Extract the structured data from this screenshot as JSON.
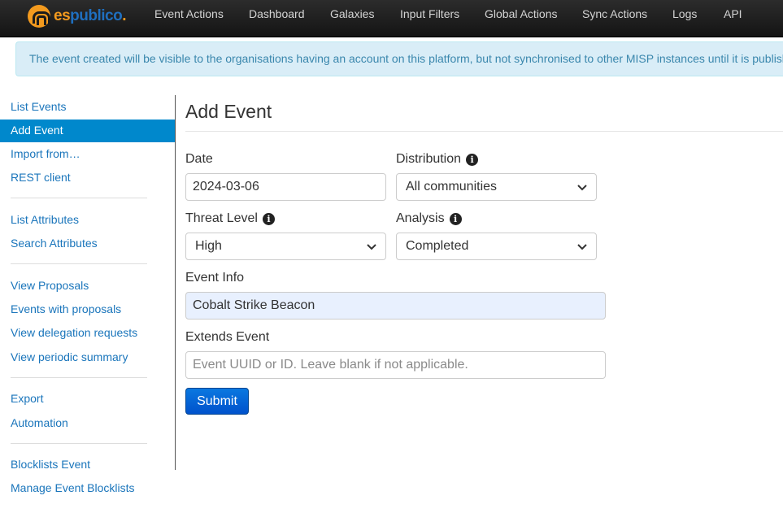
{
  "brand": {
    "text_es": "es",
    "text_publico": "publico",
    "text_dot": ".",
    "logo_icon": "espublico-logo-icon"
  },
  "nav": {
    "items": [
      "Event Actions",
      "Dashboard",
      "Galaxies",
      "Input Filters",
      "Global Actions",
      "Sync Actions",
      "Logs",
      "API"
    ]
  },
  "alert": {
    "text": "The event created will be visible to the organisations having an account on this platform, but not synchronised to other MISP instances until it is published."
  },
  "sidebar": {
    "items": [
      "List Events",
      "Add Event",
      "Import from…",
      "REST client",
      "List Attributes",
      "Search Attributes",
      "View Proposals",
      "Events with proposals",
      "View delegation requests",
      "View periodic summary",
      "Export",
      "Automation",
      "Blocklists Event",
      "Manage Event Blocklists"
    ],
    "active": "Add Event"
  },
  "form": {
    "title": "Add Event",
    "date_label": "Date",
    "date_value": "2024-03-06",
    "distribution_label": "Distribution",
    "distribution_value": "All communities",
    "threat_level_label": "Threat Level",
    "threat_level_value": "High",
    "analysis_label": "Analysis",
    "analysis_value": "Completed",
    "event_info_label": "Event Info",
    "event_info_value": "Cobalt Strike Beacon",
    "extends_label": "Extends Event",
    "extends_placeholder": "Event UUID or ID. Leave blank if not applicable.",
    "submit_label": "Submit",
    "info_glyph": "i"
  },
  "colors": {
    "navbar": "#1b1b1b",
    "brand_orange": "#f39a1e",
    "brand_blue": "#1f6fbf",
    "link": "#1a75bb",
    "active_item": "#0088cc",
    "alert_bg": "#d9edf7",
    "alert_text": "#3a87ad",
    "submit": "#0a6fd8"
  }
}
